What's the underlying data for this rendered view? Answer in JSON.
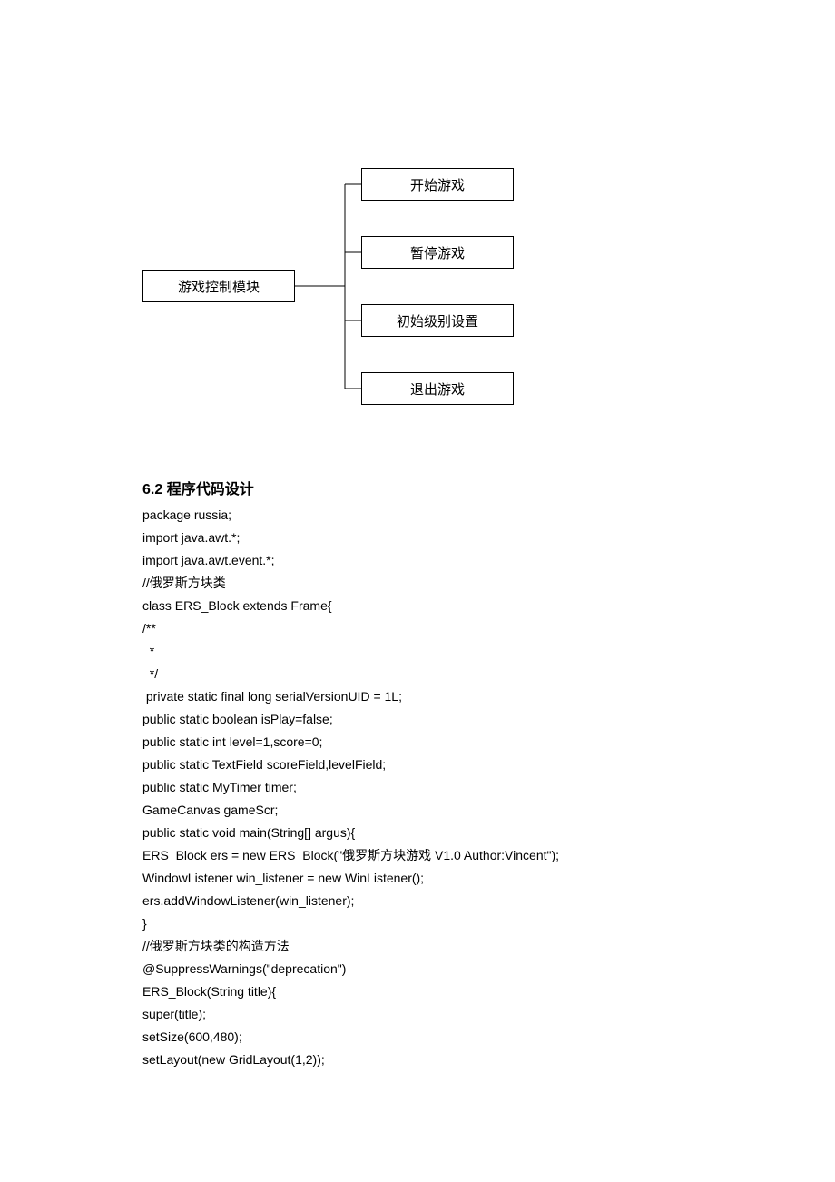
{
  "diagram": {
    "root": "游戏控制模块",
    "leaves": [
      "开始游戏",
      "暂停游戏",
      "初始级别设置",
      "退出游戏"
    ]
  },
  "section": {
    "heading": "6.2 程序代码设计",
    "code": [
      "package russia;",
      "import java.awt.*;",
      "import java.awt.event.*;",
      "//俄罗斯方块类",
      "class ERS_Block extends Frame{",
      "/**",
      "  *",
      "  */",
      " private static final long serialVersionUID = 1L;",
      "public static boolean isPlay=false;",
      "public static int level=1,score=0;",
      "public static TextField scoreField,levelField;",
      "public static MyTimer timer;",
      "GameCanvas gameScr;",
      "public static void main(String[] argus){",
      "ERS_Block ers = new ERS_Block(\"俄罗斯方块游戏 V1.0 Author:Vincent\");",
      "WindowListener win_listener = new WinListener();",
      "ers.addWindowListener(win_listener);",
      "}",
      "//俄罗斯方块类的构造方法",
      "@SuppressWarnings(\"deprecation\")",
      "ERS_Block(String title){",
      "super(title);",
      "setSize(600,480);",
      "setLayout(new GridLayout(1,2));"
    ]
  }
}
